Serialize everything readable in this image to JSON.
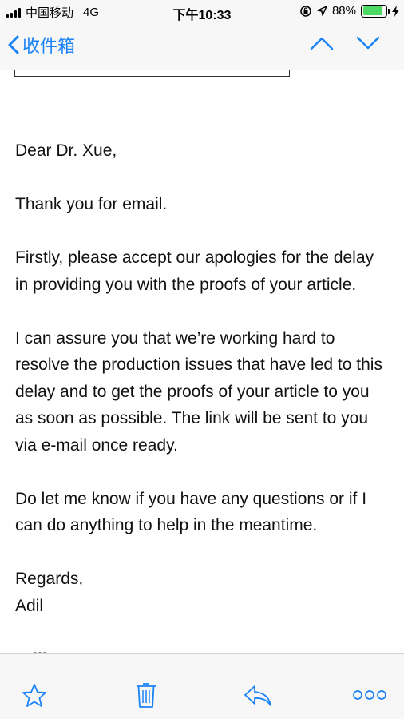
{
  "status_bar": {
    "carrier": "中国移动",
    "network": "4G",
    "time": "下午10:33",
    "battery_percent": "88%",
    "battery_level": 0.88,
    "battery_color": "#4cd964"
  },
  "nav": {
    "back_label": "收件箱",
    "accent_color": "#1a82f7",
    "prev_icon": "chevron-up-icon",
    "next_icon": "chevron-down-icon"
  },
  "email": {
    "greeting": "Dear Dr. Xue,",
    "paragraphs": [
      "Thank you for email.",
      "Firstly, please accept our apologies for the delay in providing you with the proofs of your article.",
      "I can assure you that we’re working hard to resolve the production issues that have led to this delay and to get the proofs of your article to you as soon as possible. The link will be sent to you via e-mail once ready.",
      "Do let me know if you have any questions or if I can do anything to help in the meantime."
    ],
    "closing": "Regards,",
    "signature": "Adil",
    "sender_name": "Adil Noor"
  },
  "toolbar": {
    "icons": [
      "star-icon",
      "trash-icon",
      "reply-icon",
      "more-icon"
    ]
  }
}
